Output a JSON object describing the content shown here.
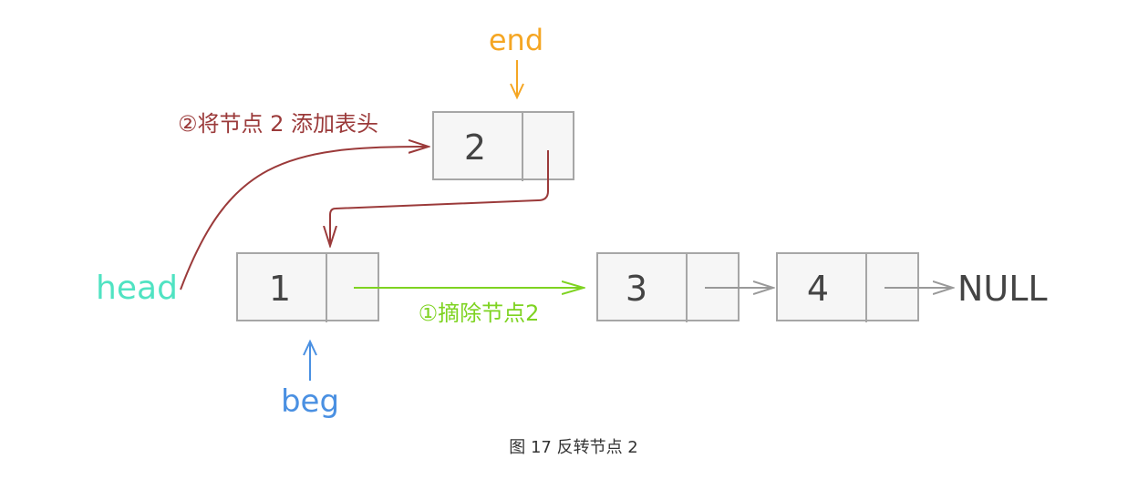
{
  "nodes": [
    {
      "value": "1"
    },
    {
      "value": "2"
    },
    {
      "value": "3"
    },
    {
      "value": "4"
    }
  ],
  "null_label": "NULL",
  "pointers": {
    "head": "head",
    "end": "end",
    "beg": "beg"
  },
  "steps": {
    "remove": "①摘除节点2",
    "add_head": "②将节点 2 添加表头"
  },
  "caption": "图 17 反转节点 2",
  "colors": {
    "head": "#50e3c2",
    "end": "#f5a623",
    "beg": "#4a90e2",
    "remove": "#7ed321",
    "add_head": "#9b3a3a",
    "node_border": "#a6a6a6"
  }
}
